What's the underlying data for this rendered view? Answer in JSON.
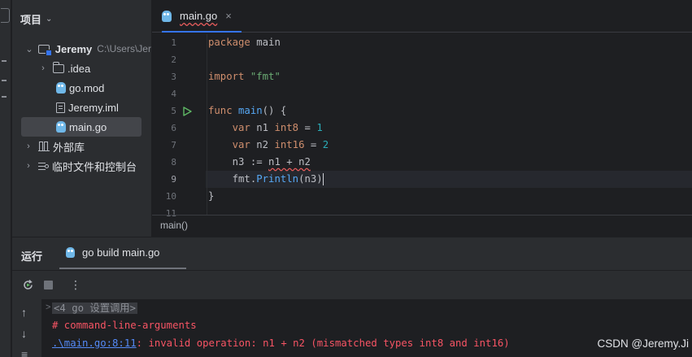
{
  "project_panel": {
    "title": "项目",
    "tree": [
      {
        "label": "Jeremy",
        "hint": "C:\\Users\\Jer",
        "icon": "module-folder-icon",
        "arrow": "expanded"
      },
      {
        "label": ".idea",
        "icon": "folder-icon",
        "arrow": "collapsed"
      },
      {
        "label": "go.mod",
        "icon": "gopher-icon"
      },
      {
        "label": "Jeremy.iml",
        "icon": "file-icon"
      },
      {
        "label": "main.go",
        "icon": "gopher-icon",
        "selected": true
      },
      {
        "label": "外部库",
        "icon": "library-icon",
        "arrow": "collapsed"
      },
      {
        "label": "临时文件和控制台",
        "icon": "scratch-icon",
        "arrow": "collapsed"
      }
    ]
  },
  "editor": {
    "tab_label": "main.go",
    "tab_close": "×",
    "line_numbers": [
      "1",
      "2",
      "3",
      "4",
      "5",
      "6",
      "7",
      "8",
      "9",
      "10",
      "11"
    ],
    "code": {
      "l1_kw": "package",
      "l1_rest": " main",
      "l3_kw": "import",
      "l3_str": "\"fmt\"",
      "l5_kw": "func",
      "l5_fn": "main",
      "l5_rest": "() {",
      "l6_kw": "var",
      "l6_name": " n1 ",
      "l6_type": "int8",
      "l6_eq": " = ",
      "l6_num": "1",
      "l7_kw": "var",
      "l7_name": " n2 ",
      "l7_type": "int16",
      "l7_eq": " = ",
      "l7_num": "2",
      "l8_a": "n3 := ",
      "l8_err": "n1 + n2",
      "l9_pkg": "fmt.",
      "l9_fn": "Println",
      "l9_paren": "(",
      "l9_arg": "n3",
      "l9_close": ")",
      "l10": "}"
    },
    "breadcrumb": "main()"
  },
  "run_panel": {
    "title": "运行",
    "tab_label": "go build main.go",
    "console": {
      "fold": "<4 go 设置调用>",
      "fold_marker": ">",
      "line2": "# command-line-arguments",
      "line3_link": ".\\main.go:8:11",
      "line3_msg": ": invalid operation: n1 + n2 (mismatched types int8 and int16)"
    }
  },
  "watermark": "CSDN @Jeremy.Ji",
  "colors": {
    "accent": "#3574f0",
    "keyword": "#cf8e6d",
    "string": "#6aab73",
    "number": "#2aacb8",
    "function": "#56a8f5",
    "error": "#f75464",
    "link": "#548af7",
    "run_green": "#5fb865"
  }
}
